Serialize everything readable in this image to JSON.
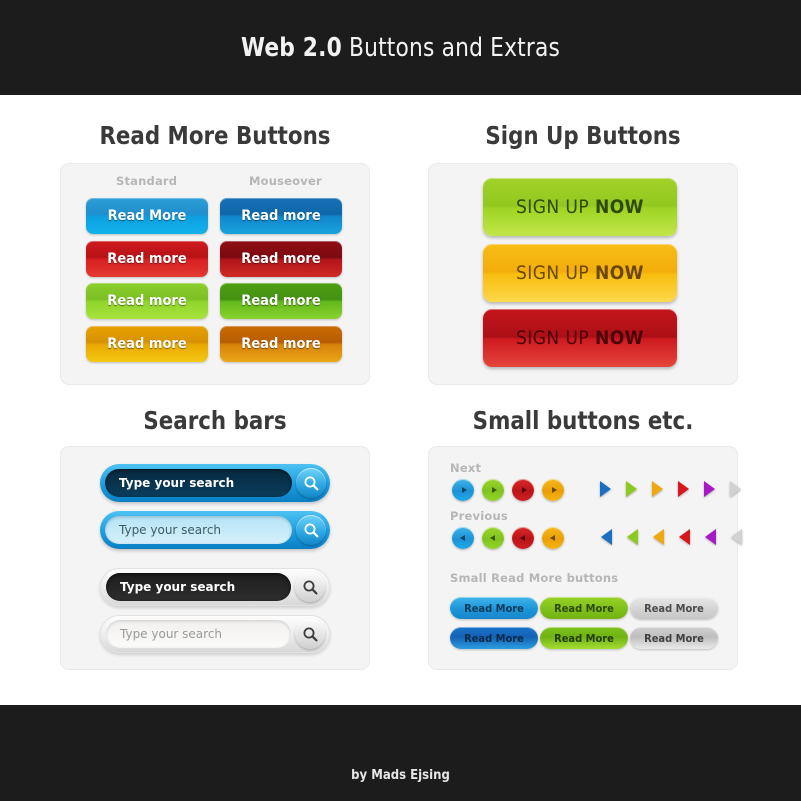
{
  "header": {
    "title_bold": "Web 2.0",
    "title_light": " Buttons and Extras"
  },
  "footer": {
    "credit": "by Mads Ejsing"
  },
  "sections": {
    "read_more": {
      "title": "Read More Buttons",
      "col_standard_label": "Standard",
      "col_mouseover_label": "Mouseover",
      "standard": [
        {
          "label": "Read More",
          "color": "#1f8fcd"
        },
        {
          "label": "Read more",
          "color": "#cf1a1d"
        },
        {
          "label": "Read more",
          "color": "#8dce2b"
        },
        {
          "label": "Read more",
          "color": "#e8a000"
        }
      ],
      "mouseover": [
        {
          "label": "Read more",
          "color": "#1671b5"
        },
        {
          "label": "Read more",
          "color": "#8f0d14"
        },
        {
          "label": "Read more",
          "color": "#4f9f14"
        },
        {
          "label": "Read more",
          "color": "#c96a04"
        }
      ]
    },
    "sign_up": {
      "title": "Sign Up Buttons",
      "buttons": [
        {
          "text": "SIGN UP",
          "strong": "NOW",
          "color": "#9ed423"
        },
        {
          "text": "SIGN UP",
          "strong": "NOW",
          "color": "#f8bc0e"
        },
        {
          "text": "SIGN UP",
          "strong": "NOW",
          "color": "#cf1a20"
        }
      ]
    },
    "search_bars": {
      "title": "Search bars",
      "bars": [
        {
          "value": "Type your search",
          "theme": "dark-blue"
        },
        {
          "placeholder": "Type your search",
          "theme": "light-blue"
        },
        {
          "value": "Type your search",
          "theme": "black"
        },
        {
          "placeholder": "Type your search",
          "theme": "white"
        }
      ]
    },
    "small_buttons": {
      "title": "Small buttons etc.",
      "next_label": "Next",
      "previous_label": "Previous",
      "small_read_more_label": "Small Read More buttons",
      "circle_colors": [
        "#1b93d6",
        "#7fc41d",
        "#bb1418",
        "#eaa006"
      ],
      "arrow_colors": [
        "#1b6fc0",
        "#8cc81e",
        "#f0a90d",
        "#d8171c",
        "#a819c6",
        "#d2d2d2"
      ],
      "small_read_more": [
        {
          "label": "Read More",
          "variant": "blue-a"
        },
        {
          "label": "Read More",
          "variant": "green-a"
        },
        {
          "label": "Read More",
          "variant": "grey-a"
        },
        {
          "label": "Read More",
          "variant": "blue-b"
        },
        {
          "label": "Read More",
          "variant": "green-b"
        },
        {
          "label": "Read More",
          "variant": "grey-b"
        }
      ]
    }
  }
}
